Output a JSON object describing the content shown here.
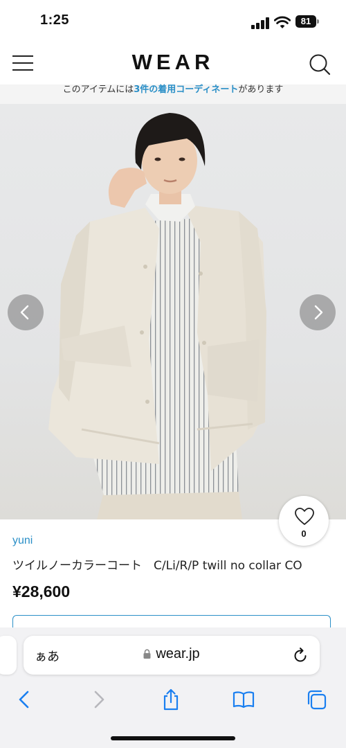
{
  "status": {
    "time": "1:25",
    "battery": "81"
  },
  "header": {
    "brand": "WEAR"
  },
  "notice": {
    "prefix": "このアイテムには",
    "link": "3件の着用コーディネート",
    "suffix": "があります"
  },
  "product": {
    "brand": "yuni",
    "name": "ツイルノーカラーコート　C/Li/R/P twill no collar CO",
    "price": "¥28,600",
    "likes": "0"
  },
  "browser": {
    "text_size_label": "ぁあ",
    "url": "wear.jp"
  },
  "colors": {
    "accent": "#2a8fc7",
    "coat": "#e9e4d9",
    "shirt_stripe": "#8a8f95"
  },
  "icons": [
    "hamburger-icon",
    "search-icon",
    "chevron-left-icon",
    "chevron-right-icon",
    "heart-icon",
    "lock-icon",
    "reload-icon",
    "back-icon",
    "forward-icon",
    "share-icon",
    "bookmarks-icon",
    "tabs-icon"
  ]
}
